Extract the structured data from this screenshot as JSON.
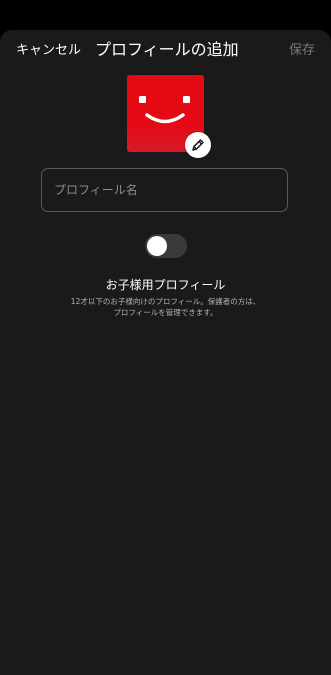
{
  "header": {
    "cancel_label": "キャンセル",
    "title": "プロフィールの追加",
    "save_label": "保存"
  },
  "avatar": {
    "color": "#e50914",
    "icon": "smiley-face-icon",
    "edit_icon": "pencil-icon"
  },
  "name_field": {
    "placeholder": "プロフィール名",
    "value": ""
  },
  "kids_toggle": {
    "on": false
  },
  "kids_profile": {
    "title": "お子様用プロフィール",
    "desc_line1": "12才以下のお子様向けのプロフィール。保護者の方は、",
    "desc_line2": "プロフィールを管理できます。"
  },
  "colors": {
    "background": "#1a1a1a",
    "accent": "#e50914",
    "muted_text": "#7a7a7a"
  }
}
